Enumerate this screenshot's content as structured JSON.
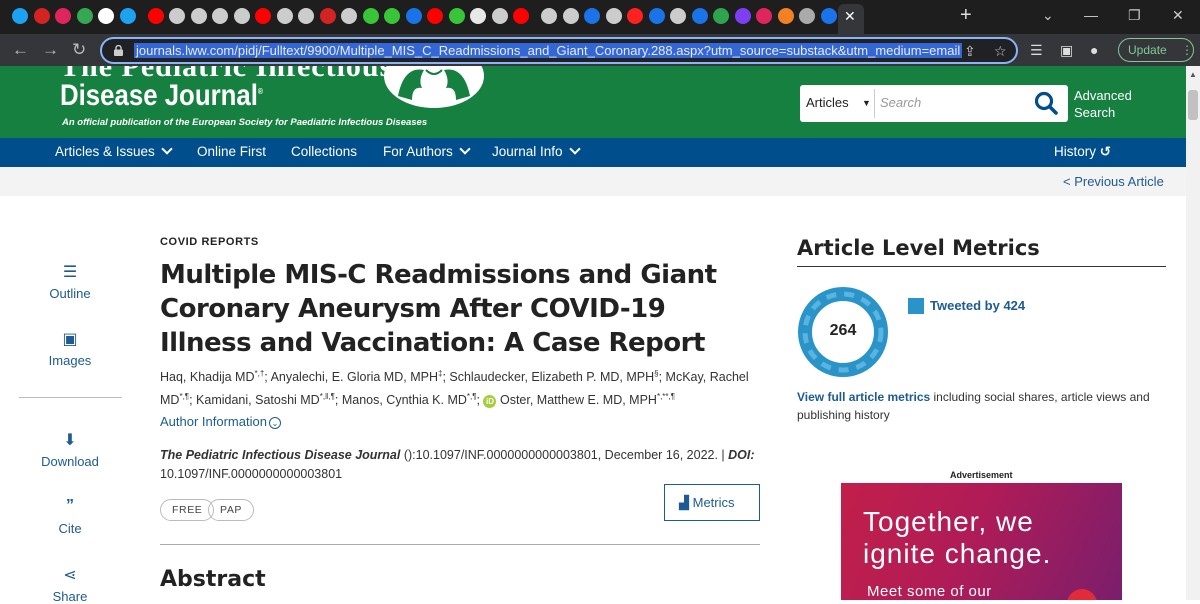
{
  "browser": {
    "url": "journals.lww.com/pidj/Fulltext/9900/Multiple_MIS_C_Readmissions_and_Giant_Coronary.288.aspx?utm_source=substack&utm_medium=email",
    "update_label": "Update",
    "tab_favicon_colors": [
      "#1da1f2",
      "#d32323",
      "#e0245e",
      "#34a853",
      "#ffffff",
      "#1da1f2",
      "#ff0000",
      "#cccccc",
      "#cccccc",
      "#cccccc",
      "#cccccc",
      "#ff0000",
      "#cccccc",
      "#cccccc",
      "#d32323",
      "#cccccc",
      "#38c538",
      "#38c538",
      "#1a73e8",
      "#ff0000",
      "#38c538",
      "#e8e8e8",
      "#cccccc",
      "#ff0000",
      "#cccccc",
      "#cccccc",
      "#1a73e8",
      "#cccccc",
      "#ff2020",
      "#1a73e8",
      "#cccccc",
      "#1a73e8",
      "#2ea44f",
      "#7e3ff2",
      "#e0245e",
      "#f48024",
      "#aaaaaa",
      "#1a73e8"
    ]
  },
  "masthead": {
    "line1": "The Pediatric Infectious",
    "line2": "Disease Journal",
    "registered": "®",
    "tagline": "An official publication of the European Society for Paediatric Infectious Diseases"
  },
  "search": {
    "scope": "Articles",
    "placeholder": "Search",
    "advanced": "Advanced Search"
  },
  "nav": {
    "items": [
      "Articles & Issues",
      "Online First",
      "Collections",
      "For Authors",
      "Journal Info"
    ],
    "history": "History"
  },
  "subbar": {
    "previous": "< Previous Article"
  },
  "rail": {
    "outline": "Outline",
    "images": "Images",
    "download": "Download",
    "cite": "Cite",
    "share": "Share"
  },
  "article": {
    "section": "COVID REPORTS",
    "title": "Multiple MIS-C Readmissions and Giant Coronary Aneurysm After COVID-19 Illness and Vaccination: A Case Report",
    "authors": [
      {
        "name": "Haq, Khadija MD",
        "sup": "*,†"
      },
      {
        "name": "Anyalechi, E. Gloria MD, MPH",
        "sup": "‡"
      },
      {
        "name": "Schlaudecker, Elizabeth P. MD, MPH",
        "sup": "§"
      },
      {
        "name": "McKay, Rachel MD",
        "sup": "*,¶"
      },
      {
        "name": "Kamidani, Satoshi MD",
        "sup": "*,‖,¶"
      },
      {
        "name": "Manos, Cynthia K. MD",
        "sup": "*,¶"
      },
      {
        "name": "Oster, Matthew E. MD, MPH",
        "sup": "*,**,¶"
      }
    ],
    "author_info": "Author Information",
    "journal": "The Pediatric Infectious Disease Journal",
    "citation_rest": " ():10.1097/INF.0000000000003801, December 16, 2022. | ",
    "doi_label": "DOI:",
    "doi": "10.1097/INF.0000000000003801",
    "badges": [
      "FREE",
      "PAP"
    ],
    "metrics_button": "Metrics",
    "abstract_heading": "Abstract"
  },
  "metrics": {
    "title": "Article Level Metrics",
    "score": "264",
    "tweeted": "Tweeted by 424",
    "link": "View full article metrics",
    "desc": " including social shares, article views and publishing history"
  },
  "ad": {
    "label": "Advertisement",
    "line1a": "Together, we",
    "line1b": "ignite change.",
    "line2": "Meet some of our"
  }
}
